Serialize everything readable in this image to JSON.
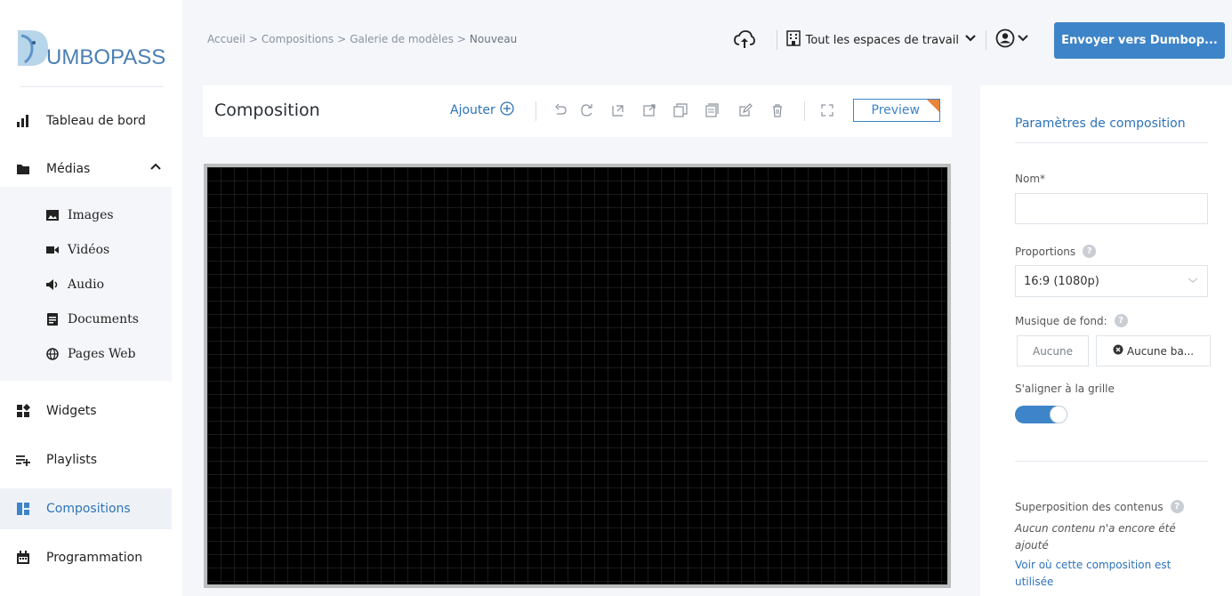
{
  "brand": {
    "logo_text": "UMBOPASS",
    "accent": "#3e84c8",
    "logo_color": "#4a7fb4"
  },
  "sidebar": {
    "items": [
      {
        "label": "Tableau de bord",
        "icon": "bar-chart-icon"
      },
      {
        "label": "Médias",
        "icon": "folder-icon"
      },
      {
        "label": "Widgets",
        "icon": "widgets-icon"
      },
      {
        "label": "Playlists",
        "icon": "playlist-add-icon"
      },
      {
        "label": "Compositions",
        "icon": "compositions-icon",
        "active": true
      },
      {
        "label": "Programmation",
        "icon": "calendar-icon"
      }
    ],
    "media_subitems": [
      {
        "label": "Images",
        "icon": "image-icon"
      },
      {
        "label": "Vidéos",
        "icon": "video-icon"
      },
      {
        "label": "Audio",
        "icon": "speaker-icon"
      },
      {
        "label": "Documents",
        "icon": "document-icon"
      },
      {
        "label": "Pages Web",
        "icon": "globe-icon"
      }
    ]
  },
  "breadcrumb": {
    "items": [
      "Accueil",
      "Compositions",
      "Galerie de modèles",
      "Nouveau"
    ],
    "separator": ">"
  },
  "topbar": {
    "workspace_label": "Tout les espaces de travail",
    "send_button": "Envoyer vers Dumbop..."
  },
  "composition": {
    "title": "Composition",
    "add_label": "Ajouter",
    "preview_label": "Preview",
    "tools": [
      "undo-icon",
      "redo-icon",
      "send-to-back-icon",
      "bring-to-front-icon",
      "duplicate-icon",
      "copy-icon",
      "edit-icon",
      "delete-icon",
      "fullscreen-icon"
    ]
  },
  "settings": {
    "title": "Paramètres de composition",
    "name_label": "Nom*",
    "name_value": "",
    "ratio_label": "Proportions",
    "ratio_value": "16:9 (1080p)",
    "music_label": "Musique de fond:",
    "music_select": "Aucune",
    "music_track": "Aucune ba...",
    "snap_label": "S'aligner à la grille",
    "snap_enabled": true,
    "overlay_label": "Superposition des contenus",
    "overlay_empty": "Aucun contenu n'a encore été ajouté",
    "usage_link": "Voir où cette composition est utilisée"
  }
}
